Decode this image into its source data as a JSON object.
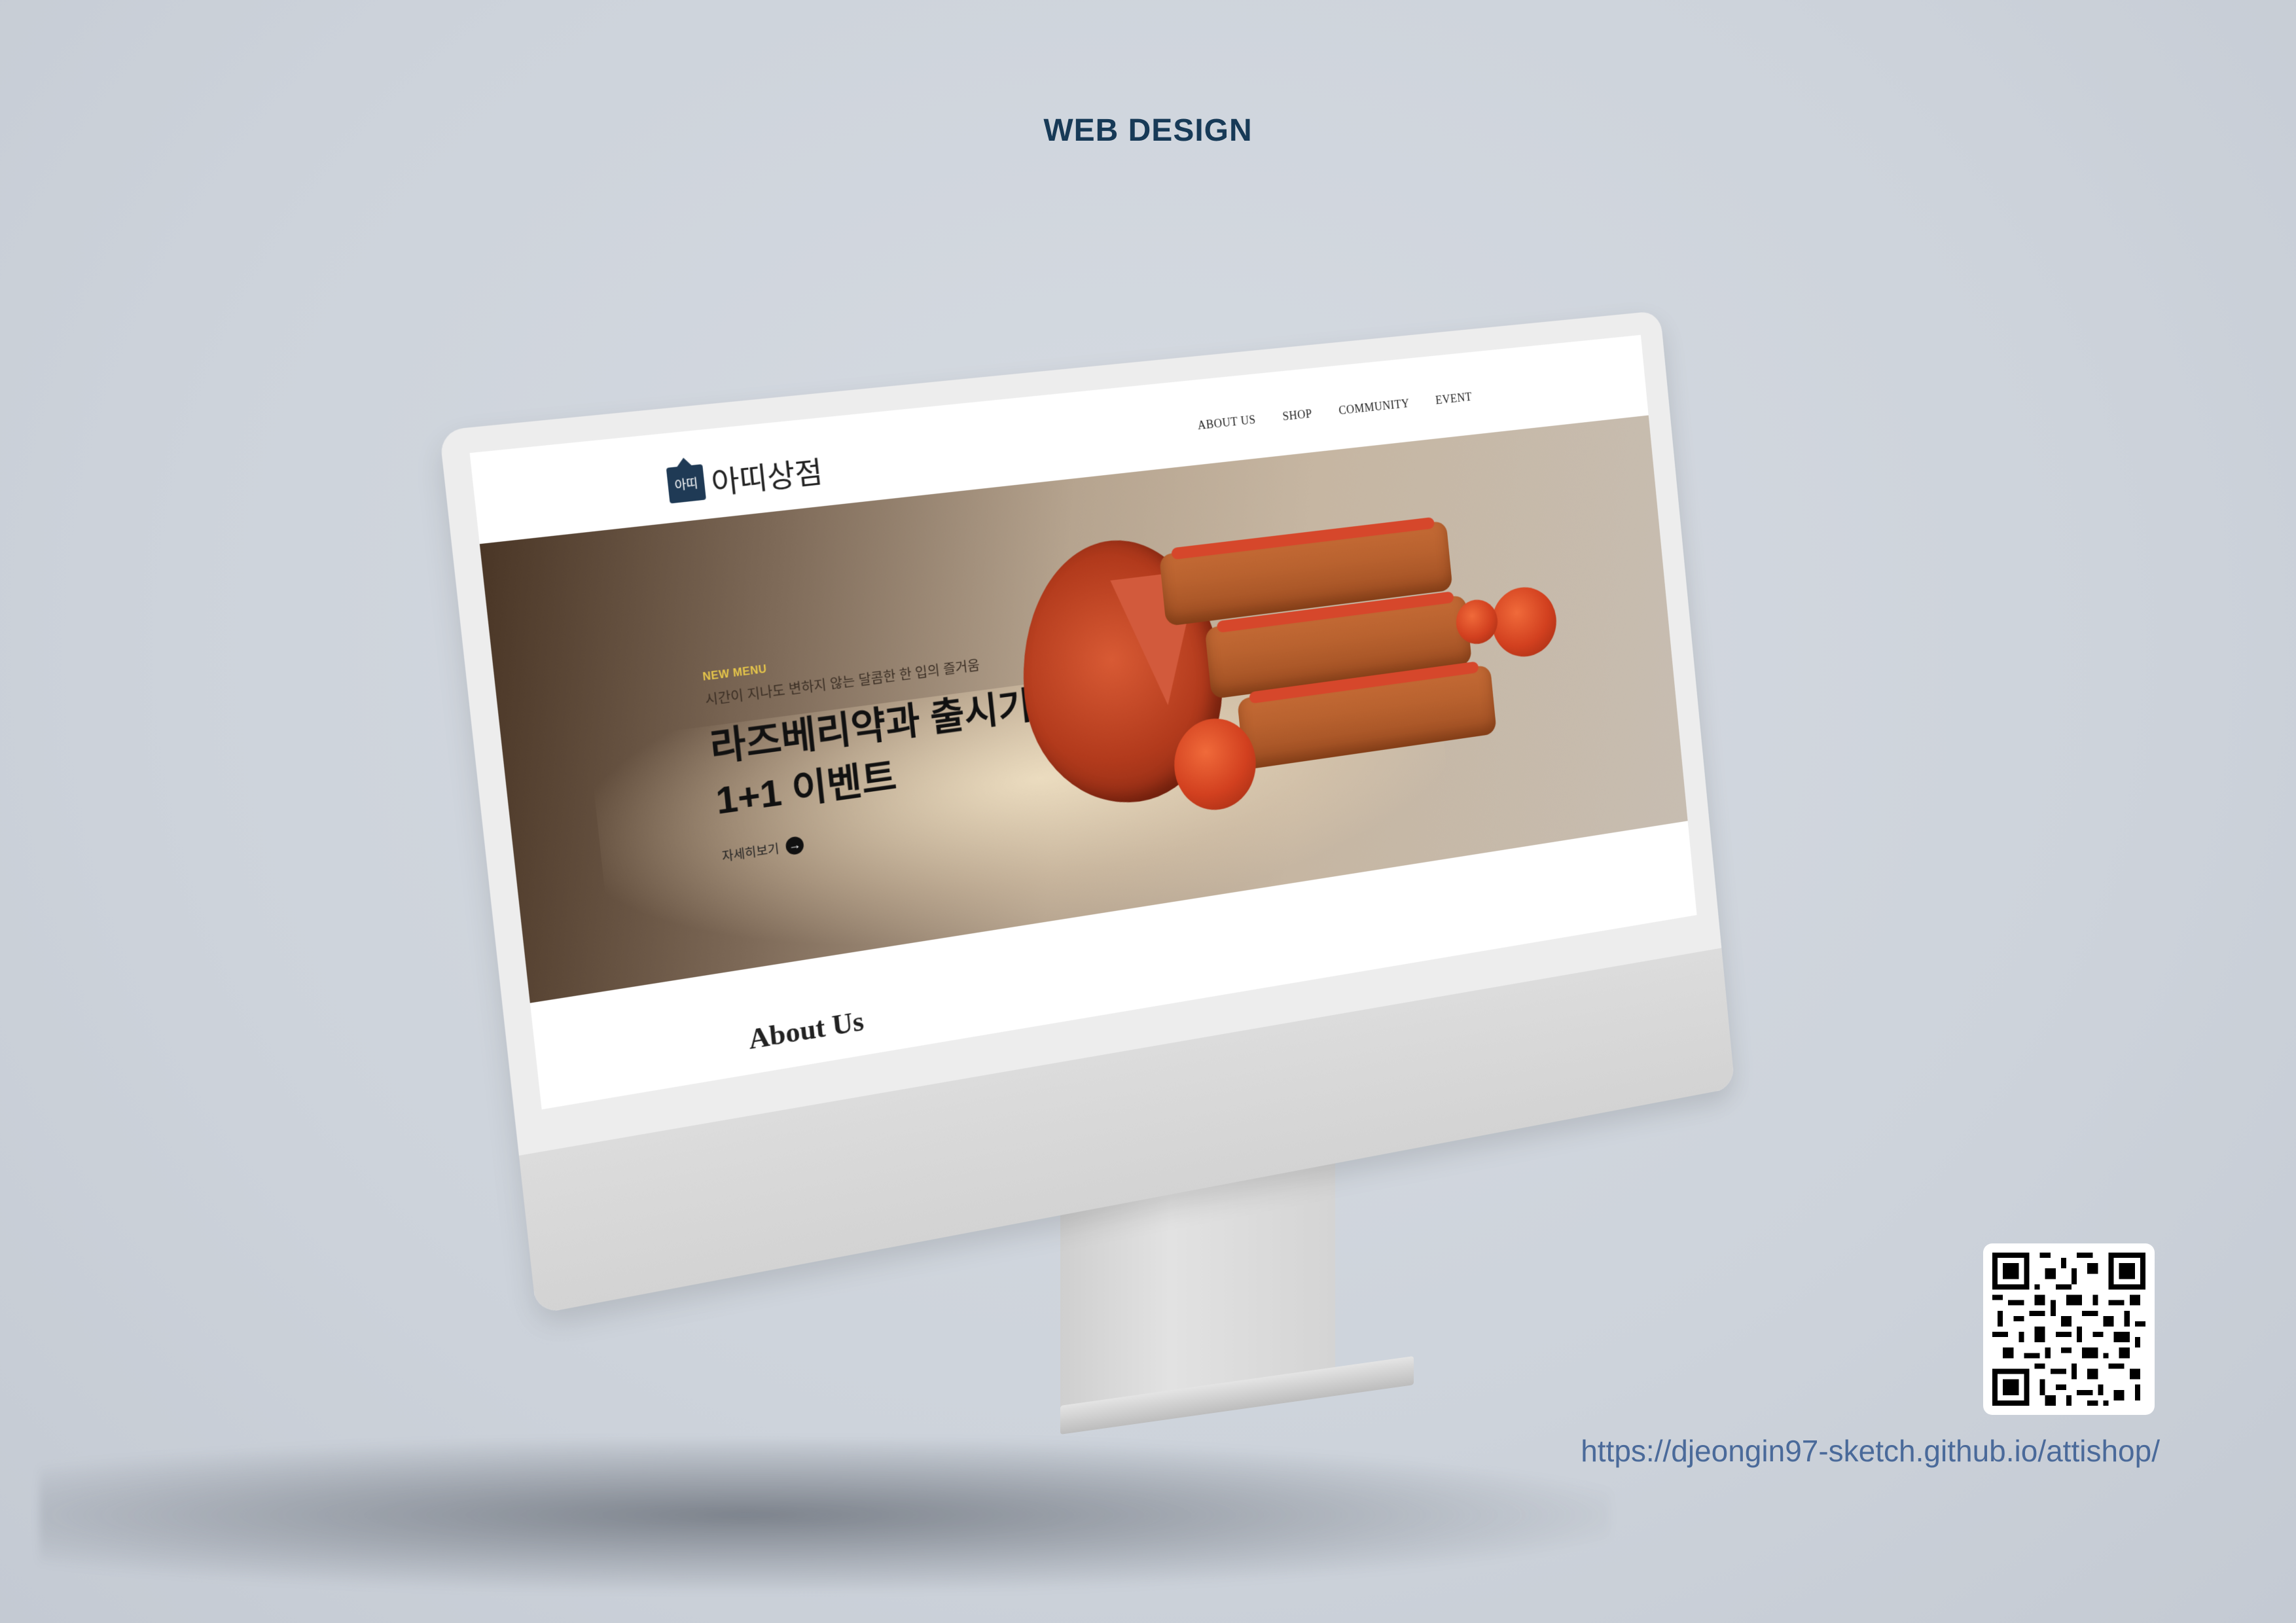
{
  "page": {
    "title": "WEB DESIGN"
  },
  "site": {
    "logo": {
      "mark": "아띠",
      "text": "아띠상점"
    },
    "nav": [
      {
        "label": "ABOUT US"
      },
      {
        "label": "SHOP"
      },
      {
        "label": "COMMUNITY"
      },
      {
        "label": "EVENT"
      }
    ],
    "hero": {
      "badge": "NEW MENU",
      "subtitle": "시간이 지나도 변하지 않는 달콤한 한 입의 즐거움",
      "title_line1": "라즈베리약과 출시기념",
      "title_line2": "1+1 이벤트",
      "more_label": "자세히보기",
      "more_icon": "arrow-right-icon"
    },
    "about_heading": "About Us"
  },
  "footer": {
    "url": "https://djeongin97-sketch.github.io/attishop/"
  },
  "colors": {
    "title": "#173a57",
    "badge": "#e6c64a",
    "url": "#4a6a9a",
    "logo": "#1f3a55"
  }
}
